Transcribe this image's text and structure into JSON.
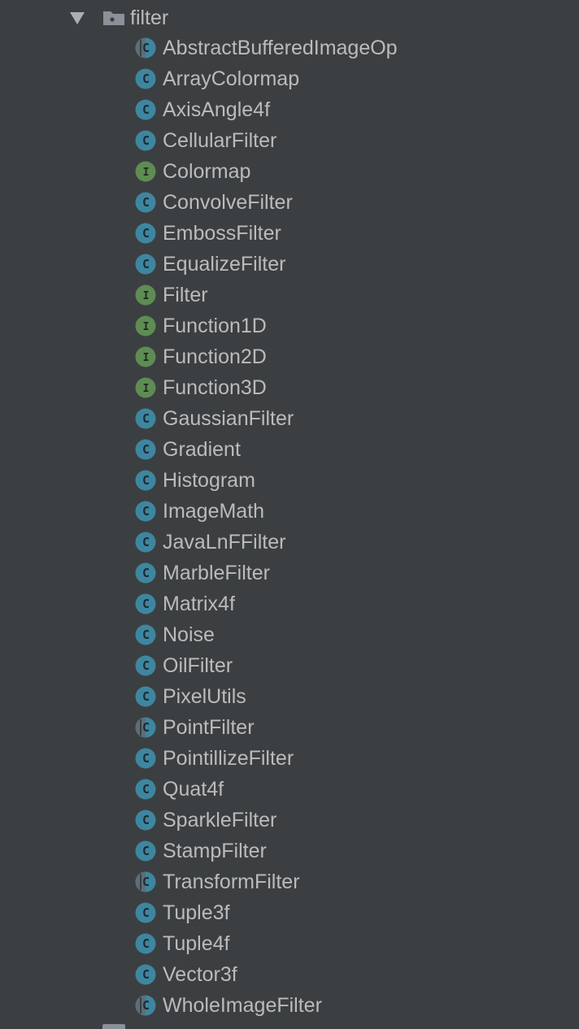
{
  "folder": {
    "name": "filter",
    "expanded": true,
    "icon": "package-folder-icon"
  },
  "colors": {
    "background": "#3c3f41",
    "text": "#bbbbbb",
    "class_icon": "#3e86a0",
    "interface_icon": "#5e8c53"
  },
  "items": [
    {
      "label": "AbstractBufferedImageOp",
      "kind": "abstract-class"
    },
    {
      "label": "ArrayColormap",
      "kind": "class"
    },
    {
      "label": "AxisAngle4f",
      "kind": "class"
    },
    {
      "label": "CellularFilter",
      "kind": "class"
    },
    {
      "label": "Colormap",
      "kind": "interface"
    },
    {
      "label": "ConvolveFilter",
      "kind": "class"
    },
    {
      "label": "EmbossFilter",
      "kind": "class"
    },
    {
      "label": "EqualizeFilter",
      "kind": "class"
    },
    {
      "label": "Filter",
      "kind": "interface"
    },
    {
      "label": "Function1D",
      "kind": "interface"
    },
    {
      "label": "Function2D",
      "kind": "interface"
    },
    {
      "label": "Function3D",
      "kind": "interface"
    },
    {
      "label": "GaussianFilter",
      "kind": "class"
    },
    {
      "label": "Gradient",
      "kind": "class"
    },
    {
      "label": "Histogram",
      "kind": "class"
    },
    {
      "label": "ImageMath",
      "kind": "class"
    },
    {
      "label": "JavaLnFFilter",
      "kind": "class"
    },
    {
      "label": "MarbleFilter",
      "kind": "class"
    },
    {
      "label": "Matrix4f",
      "kind": "class"
    },
    {
      "label": "Noise",
      "kind": "class"
    },
    {
      "label": "OilFilter",
      "kind": "class"
    },
    {
      "label": "PixelUtils",
      "kind": "class"
    },
    {
      "label": "PointFilter",
      "kind": "abstract-class"
    },
    {
      "label": "PointillizeFilter",
      "kind": "class"
    },
    {
      "label": "Quat4f",
      "kind": "class"
    },
    {
      "label": "SparkleFilter",
      "kind": "class"
    },
    {
      "label": "StampFilter",
      "kind": "class"
    },
    {
      "label": "TransformFilter",
      "kind": "abstract-class"
    },
    {
      "label": "Tuple3f",
      "kind": "class"
    },
    {
      "label": "Tuple4f",
      "kind": "class"
    },
    {
      "label": "Vector3f",
      "kind": "class"
    },
    {
      "label": "WholeImageFilter",
      "kind": "abstract-class"
    }
  ]
}
